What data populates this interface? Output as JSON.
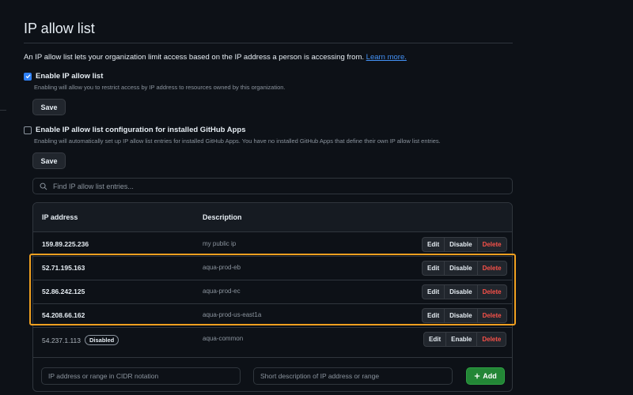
{
  "page": {
    "title": "IP allow list",
    "intro_text": "An IP allow list lets your organization limit access based on the IP address a person is accessing from.",
    "learn_more_label": "Learn more."
  },
  "enable_ip_allow_list": {
    "label": "Enable IP allow list",
    "checked": true,
    "help": "Enabling will allow you to restrict access by IP address to resources owned by this organization.",
    "save_label": "Save"
  },
  "apps_config": {
    "label": "Enable IP allow list configuration for installed GitHub Apps",
    "checked": false,
    "help": "Enabling will automatically set up IP allow list entries for installed GitHub Apps. You have no installed GitHub Apps that define their own IP allow list entries.",
    "save_label": "Save"
  },
  "search": {
    "placeholder": "Find IP allow list entries..."
  },
  "table": {
    "headers": {
      "ip": "IP address",
      "description": "Description"
    },
    "rows": [
      {
        "ip": "159.89.225.236",
        "description": "my public ip",
        "enabled": true,
        "actions": [
          "Edit",
          "Disable",
          "Delete"
        ]
      },
      {
        "ip": "52.71.195.163",
        "description": "aqua-prod-eb",
        "enabled": true,
        "actions": [
          "Edit",
          "Disable",
          "Delete"
        ]
      },
      {
        "ip": "52.86.242.125",
        "description": "aqua-prod-ec",
        "enabled": true,
        "actions": [
          "Edit",
          "Disable",
          "Delete"
        ]
      },
      {
        "ip": "54.208.66.162",
        "description": "aqua-prod-us-east1a",
        "enabled": true,
        "actions": [
          "Edit",
          "Disable",
          "Delete"
        ]
      },
      {
        "ip": "54.237.1.113",
        "description": "aqua-common",
        "enabled": false,
        "badge": "Disabled",
        "actions": [
          "Edit",
          "Enable",
          "Delete"
        ]
      }
    ]
  },
  "add_form": {
    "ip_placeholder": "IP address or range in CIDR notation",
    "description_placeholder": "Short description of IP address or range",
    "add_label": "Add"
  },
  "colors": {
    "accent": "#2f81f7",
    "danger": "#f85149",
    "primary_button": "#238636",
    "highlight": "#f0a020"
  },
  "icons": {
    "search": "search-icon",
    "plus": "plus-icon",
    "check": "checkmark-icon"
  }
}
